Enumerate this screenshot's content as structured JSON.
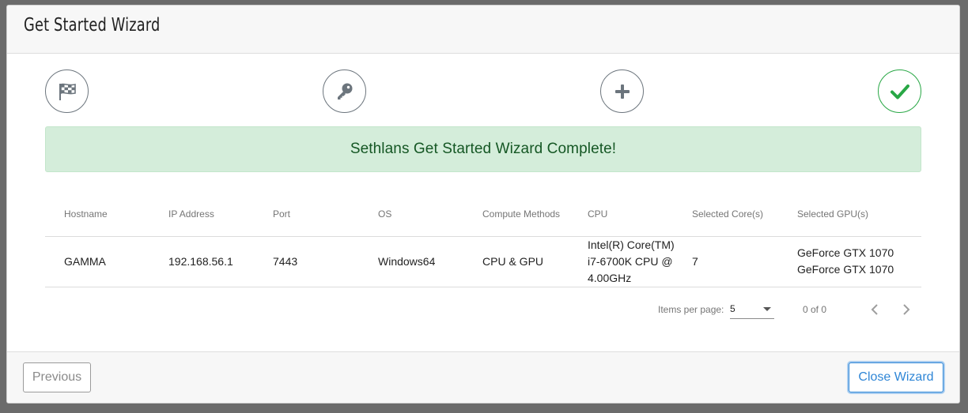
{
  "modal": {
    "title": "Get Started Wizard"
  },
  "steps": [
    {
      "icon": "flag-checkered-icon",
      "state": "visited"
    },
    {
      "icon": "key-icon",
      "state": "visited"
    },
    {
      "icon": "plus-icon",
      "state": "visited"
    },
    {
      "icon": "check-icon",
      "state": "complete"
    }
  ],
  "alert": {
    "message": "Sethlans Get Started Wizard Complete!"
  },
  "table": {
    "columns": [
      "Hostname",
      "IP Address",
      "Port",
      "OS",
      "Compute Methods",
      "CPU",
      "Selected Core(s)",
      "Selected GPU(s)"
    ],
    "rows": [
      {
        "hostname": "GAMMA",
        "ip": "192.168.56.1",
        "port": "7443",
        "os": "Windows64",
        "compute": "CPU & GPU",
        "cpu": "Intel(R) Core(TM) i7-6700K CPU @ 4.00GHz",
        "cores": "7",
        "gpus": [
          "GeForce GTX 1070",
          "GeForce GTX 1070"
        ]
      }
    ]
  },
  "paginator": {
    "items_per_page_label": "Items per page:",
    "items_per_page_value": "5",
    "range_label": "0 of 0"
  },
  "footer": {
    "previous_label": "Previous",
    "close_label": "Close Wizard"
  },
  "colors": {
    "success": "#28a745",
    "alert_bg": "#d4edda",
    "alert_text": "#155724",
    "primary": "#2f86d6"
  }
}
